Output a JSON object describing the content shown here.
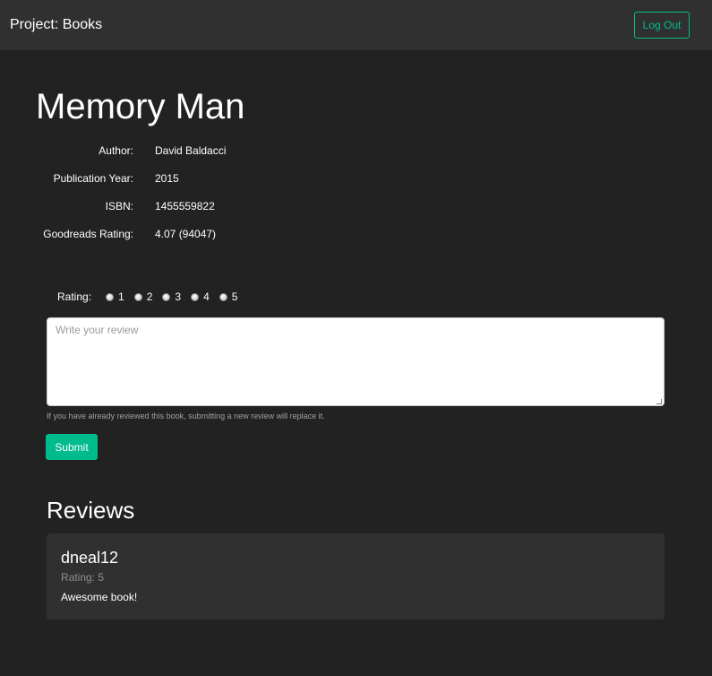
{
  "navbar": {
    "brand": "Project: Books",
    "logout_label": "Log Out"
  },
  "book": {
    "title": "Memory Man",
    "details": [
      {
        "label": "Author:",
        "value": "David Baldacci"
      },
      {
        "label": "Publication Year:",
        "value": "2015"
      },
      {
        "label": "ISBN:",
        "value": "1455559822"
      },
      {
        "label": "Goodreads Rating:",
        "value": "4.07 (94047)"
      }
    ]
  },
  "review_form": {
    "rating_label": "Rating:",
    "rating_options": [
      "1",
      "2",
      "3",
      "4",
      "5"
    ],
    "review_placeholder": "Write your review",
    "review_value": "",
    "help_text": "If you have already reviewed this book, submitting a new review will replace it.",
    "submit_label": "Submit"
  },
  "reviews": {
    "heading": "Reviews",
    "items": [
      {
        "username": "dneal12",
        "rating_text": "Rating: 5",
        "text": "Awesome book!"
      }
    ]
  },
  "colors": {
    "background": "#222222",
    "navbar": "#303030",
    "accent": "#00bc8c",
    "card": "#303030"
  }
}
